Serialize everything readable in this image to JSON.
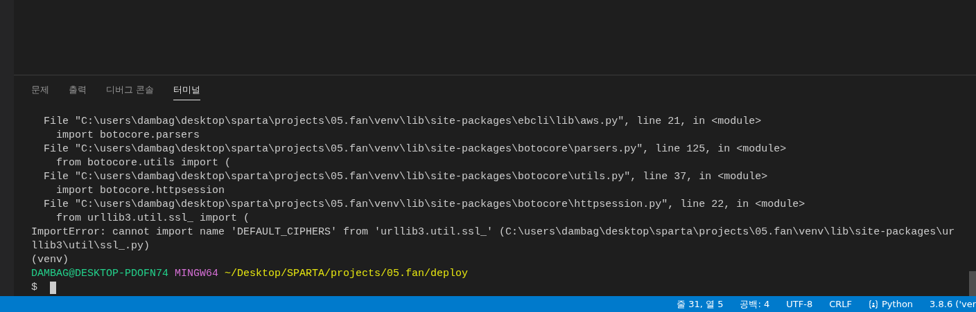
{
  "panel_tabs": [
    {
      "label": "문제",
      "selected": false
    },
    {
      "label": "출력",
      "selected": false
    },
    {
      "label": "디버그 콘솔",
      "selected": false
    },
    {
      "label": "터미널",
      "selected": true
    }
  ],
  "terminal": {
    "lines": [
      [
        {
          "text": "  File \"C:\\users\\dambag\\desktop\\sparta\\projects\\05.fan\\venv\\lib\\site-packages\\ebcli\\lib\\aws.py\", line 21, in <module>",
          "color": "#cccccc"
        }
      ],
      [
        {
          "text": "    import botocore.parsers",
          "color": "#cccccc"
        }
      ],
      [
        {
          "text": "  File \"C:\\users\\dambag\\desktop\\sparta\\projects\\05.fan\\venv\\lib\\site-packages\\botocore\\parsers.py\", line 125, in <module>",
          "color": "#cccccc"
        }
      ],
      [
        {
          "text": "    from botocore.utils import (",
          "color": "#cccccc"
        }
      ],
      [
        {
          "text": "  File \"C:\\users\\dambag\\desktop\\sparta\\projects\\05.fan\\venv\\lib\\site-packages\\botocore\\utils.py\", line 37, in <module>",
          "color": "#cccccc"
        }
      ],
      [
        {
          "text": "    import botocore.httpsession",
          "color": "#cccccc"
        }
      ],
      [
        {
          "text": "  File \"C:\\users\\dambag\\desktop\\sparta\\projects\\05.fan\\venv\\lib\\site-packages\\botocore\\httpsession.py\", line 22, in <module>",
          "color": "#cccccc"
        }
      ],
      [
        {
          "text": "    from urllib3.util.ssl_ import (",
          "color": "#cccccc"
        }
      ],
      [
        {
          "text": "ImportError: cannot import name 'DEFAULT_CIPHERS' from 'urllib3.util.ssl_' (C:\\users\\dambag\\desktop\\sparta\\projects\\05.fan\\venv\\lib\\site-packages\\ur",
          "color": "#cccccc"
        }
      ],
      [
        {
          "text": "llib3\\util\\ssl_.py)",
          "color": "#cccccc"
        }
      ],
      [
        {
          "text": "(venv)",
          "color": "#cccccc"
        }
      ],
      [
        {
          "text": "DAMBAG@DESKTOP-PDOFN74",
          "color": "#23d18b"
        },
        {
          "text": "MINGW64",
          "color": "#d670d6"
        },
        {
          "text": "~/Desktop/SPARTA/projects/05.fan/deploy",
          "color": "#e5e510"
        }
      ]
    ],
    "prompt": "$"
  },
  "status_bar": {
    "items": [
      {
        "kind": "text",
        "label": "줄 31, 열 5"
      },
      {
        "kind": "text",
        "label": "공백: 4"
      },
      {
        "kind": "text",
        "label": "UTF-8"
      },
      {
        "kind": "text",
        "label": "CRLF"
      },
      {
        "kind": "language",
        "label": "Python"
      },
      {
        "kind": "text",
        "label": "3.8.6 ('ver"
      }
    ]
  }
}
